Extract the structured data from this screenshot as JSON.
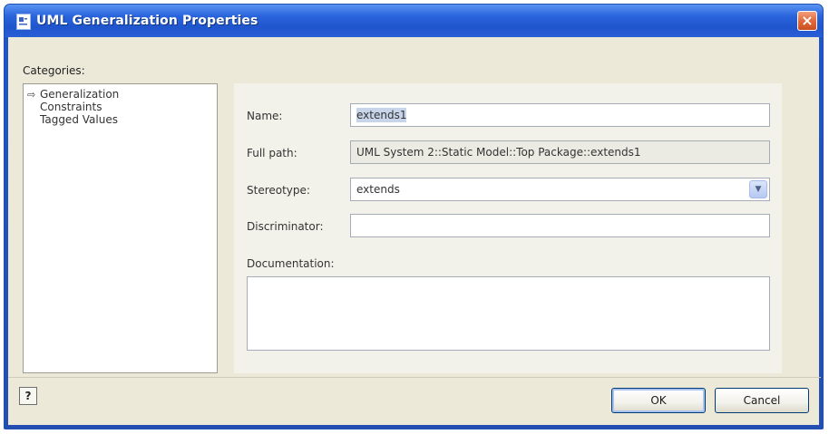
{
  "window": {
    "title": "UML Generalization Properties",
    "close_glyph": "×"
  },
  "sidebar": {
    "label": "Categories:",
    "items": [
      {
        "label": "Generalization",
        "icon": "arrow-right-icon",
        "selected": true
      },
      {
        "label": "Constraints"
      },
      {
        "label": "Tagged Values"
      }
    ]
  },
  "form": {
    "name_label": "Name:",
    "name_value": "extends1",
    "full_path_label": "Full path:",
    "full_path_value": "UML System 2::Static Model::Top Package::extends1",
    "stereotype_label": "Stereotype:",
    "stereotype_value": "extends",
    "discriminator_label": "Discriminator:",
    "discriminator_value": "",
    "documentation_label": "Documentation:",
    "documentation_value": ""
  },
  "footer": {
    "help_glyph": "?",
    "ok_label": "OK",
    "cancel_label": "Cancel"
  },
  "colors": {
    "titlebar": "#1f55cd",
    "client_bg": "#ece9d8",
    "close_button": "#e06a3d"
  }
}
